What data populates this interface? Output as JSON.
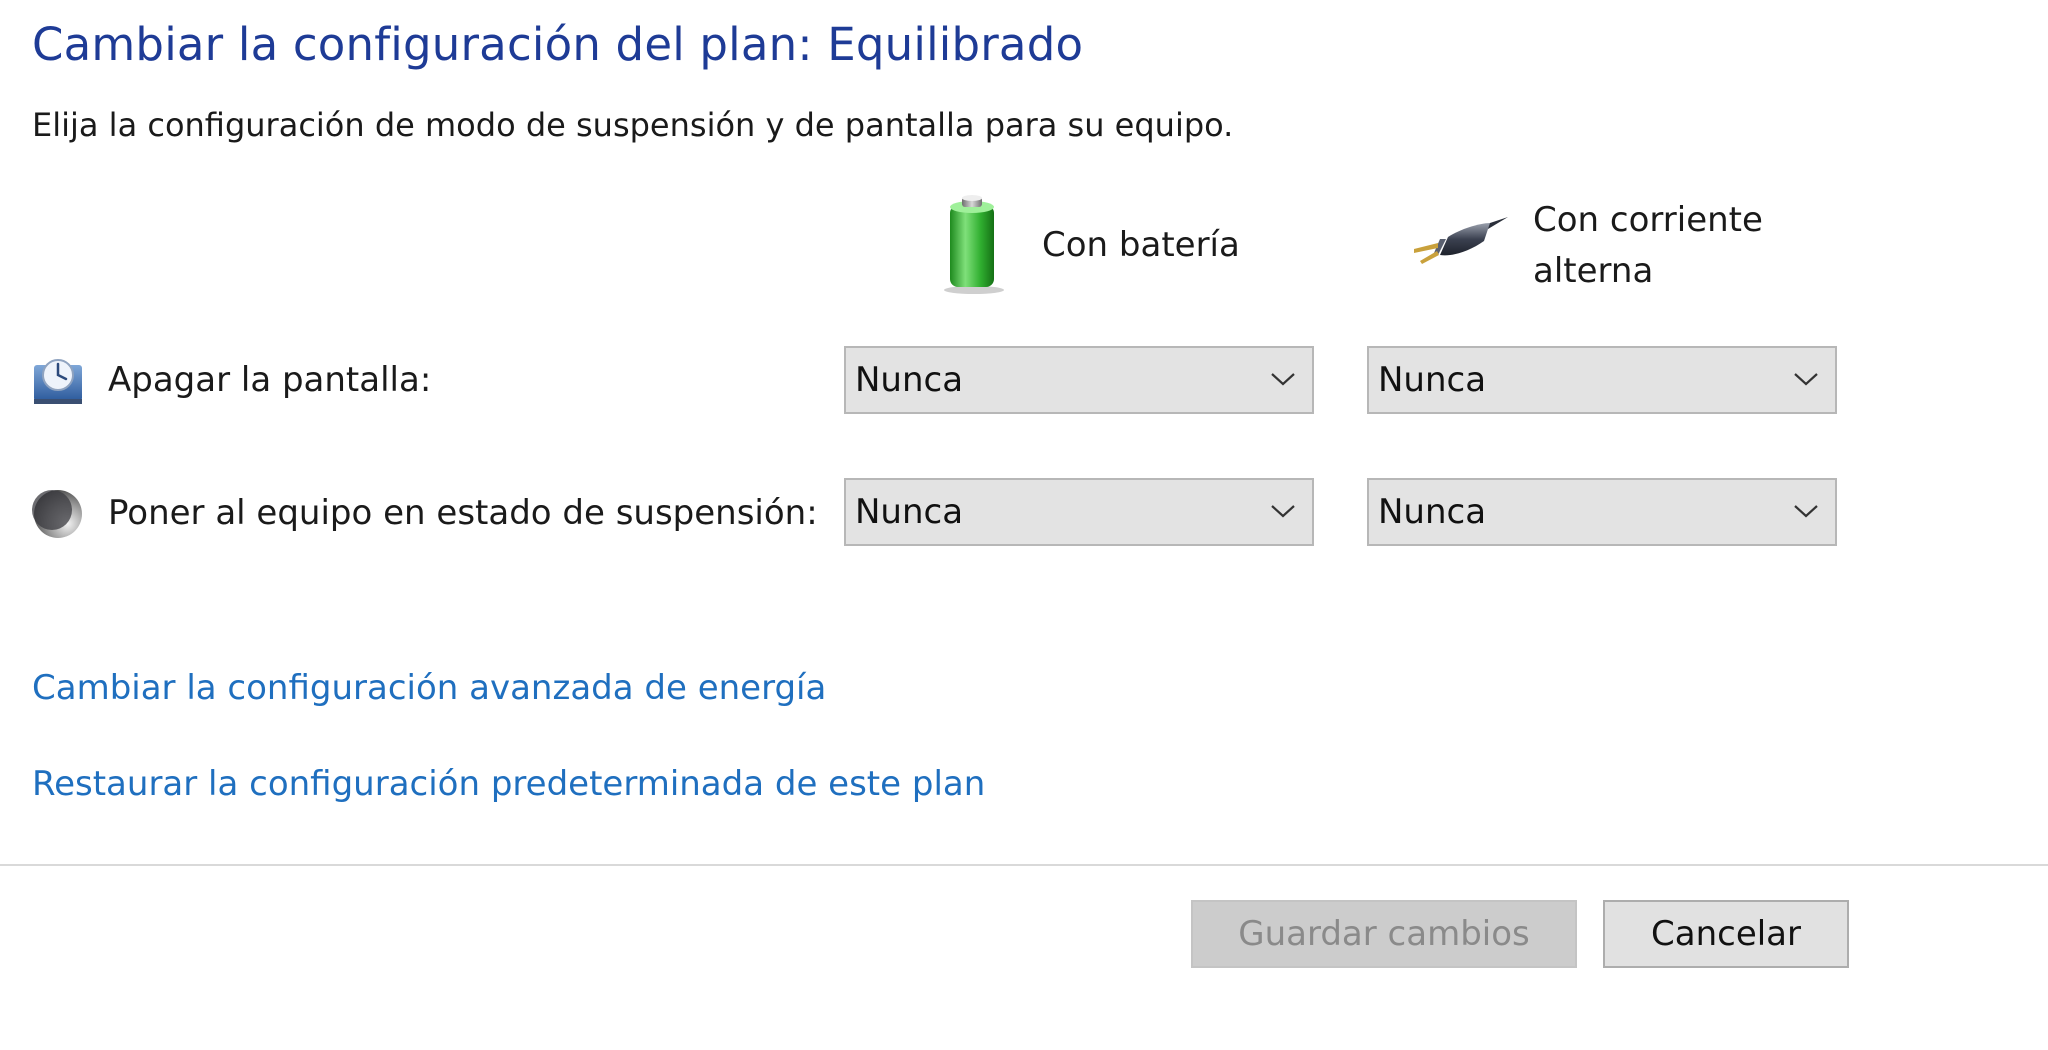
{
  "header": {
    "title": "Cambiar la configuración del plan: Equilibrado",
    "subtitle": "Elija la configuración de modo de suspensión y de pantalla para su equipo."
  },
  "columns": {
    "battery": {
      "label": "Con batería",
      "icon": "battery-icon"
    },
    "ac": {
      "label_line1": "Con corriente",
      "label_line2": "alterna",
      "icon": "power-plug-icon"
    }
  },
  "settings": [
    {
      "label": "Apagar la pantalla:",
      "icon": "monitor-clock-icon",
      "battery_value": "Nunca",
      "ac_value": "Nunca"
    },
    {
      "label": "Poner al equipo en estado de suspensión:",
      "icon": "moon-icon",
      "battery_value": "Nunca",
      "ac_value": "Nunca"
    }
  ],
  "links": {
    "advanced": "Cambiar la configuración avanzada de energía",
    "restore": "Restaurar la configuración predeterminada de este plan"
  },
  "buttons": {
    "save": "Guardar cambios",
    "save_enabled": false,
    "cancel": "Cancelar"
  },
  "colors": {
    "title": "#1e3b96",
    "link": "#1f6fbf",
    "select_bg": "#e3e3e3",
    "battery_green": "#3fbf3f"
  }
}
